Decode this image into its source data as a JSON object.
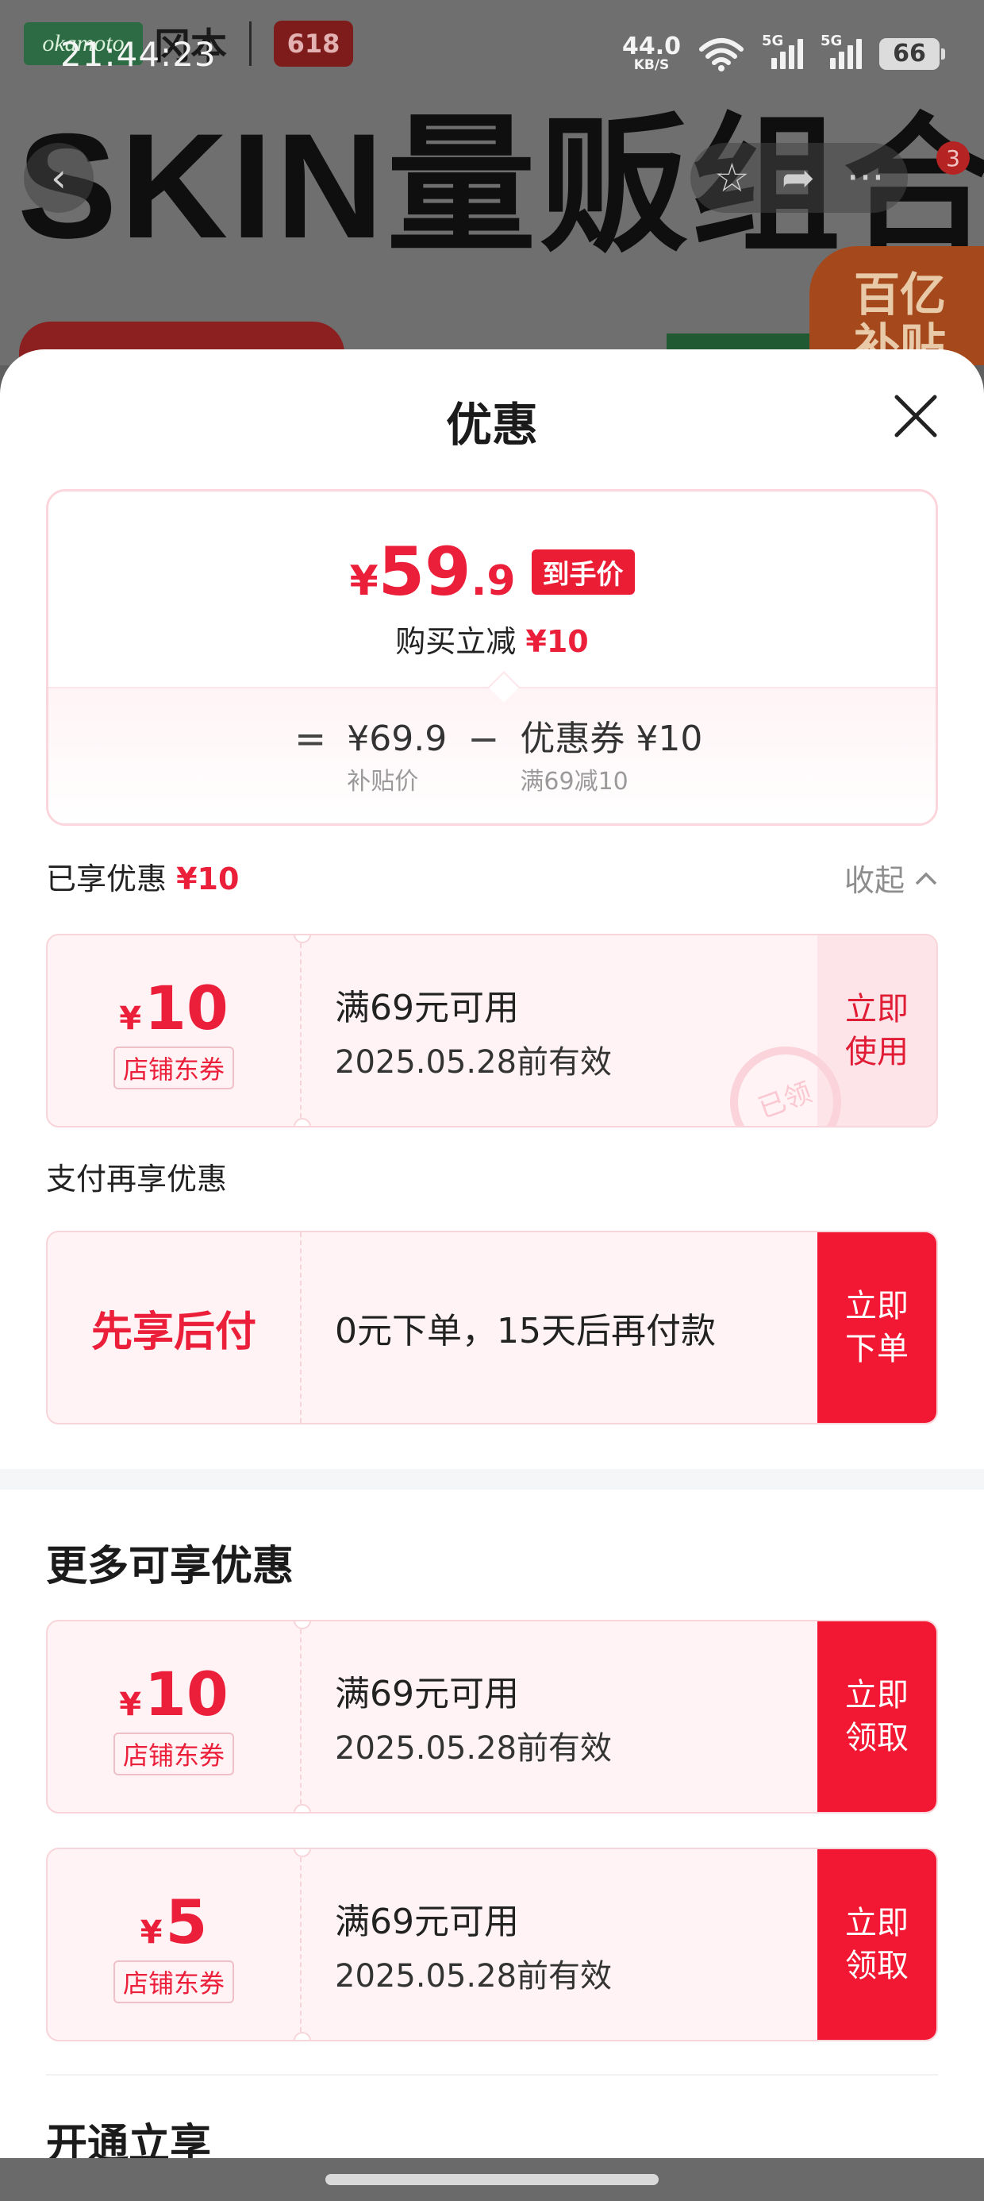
{
  "status_bar": {
    "time": "21:44:23",
    "net_speed_value": "44.0",
    "net_speed_unit": "KB/S",
    "signal1_tag": "5G",
    "signal2_tag": "5G",
    "battery": "66"
  },
  "background_page": {
    "brand_logo": "okamoto",
    "brand_cn": "冈本",
    "event_badge": "618",
    "headline": "SKIN量贩组合",
    "cart_badge": "3",
    "promo_text": "百亿\n补贴",
    "nav_icons": [
      "back-icon",
      "star-icon",
      "share-icon",
      "more-icon"
    ]
  },
  "sheet": {
    "title": "优惠",
    "close_icon": "close-icon"
  },
  "price_summary": {
    "yen": "¥",
    "price_int": "59",
    "price_dec": ".9",
    "final_tag": "到手价",
    "instant_off_label": "购买立减",
    "instant_off_value": "¥10",
    "eq": "=",
    "subsidy_price": "¥69.9",
    "subsidy_label": "补贴价",
    "minus": "−",
    "coupon_value": "优惠券 ¥10",
    "coupon_rule": "满69减10"
  },
  "enjoyed": {
    "label": "已享优惠",
    "amount": "¥10",
    "collapse_label": "收起"
  },
  "enjoyed_coupon": {
    "yen": "¥",
    "amount": "10",
    "type": "店铺东券",
    "condition": "满69元可用",
    "expiry": "2025.05.28前有效",
    "button": "立即\n使用",
    "stamp": "已领"
  },
  "pay_section": {
    "label": "支付再享优惠",
    "name": "先享后付",
    "desc": "0元下单，15天后再付款",
    "button": "立即\n下单"
  },
  "more_section": {
    "title": "更多可享优惠",
    "coupons": [
      {
        "yen": "¥",
        "amount": "10",
        "type": "店铺东券",
        "condition": "满69元可用",
        "expiry": "2025.05.28前有效",
        "button": "立即\n领取"
      },
      {
        "yen": "¥",
        "amount": "5",
        "type": "店铺东券",
        "condition": "满69元可用",
        "expiry": "2025.05.28前有效",
        "button": "立即\n领取"
      }
    ]
  },
  "cut_section": {
    "title": "开通立享"
  },
  "colors": {
    "accent_red": "#ec1f3a",
    "button_red": "#f21732",
    "coupon_bg": "#fff3f5"
  }
}
